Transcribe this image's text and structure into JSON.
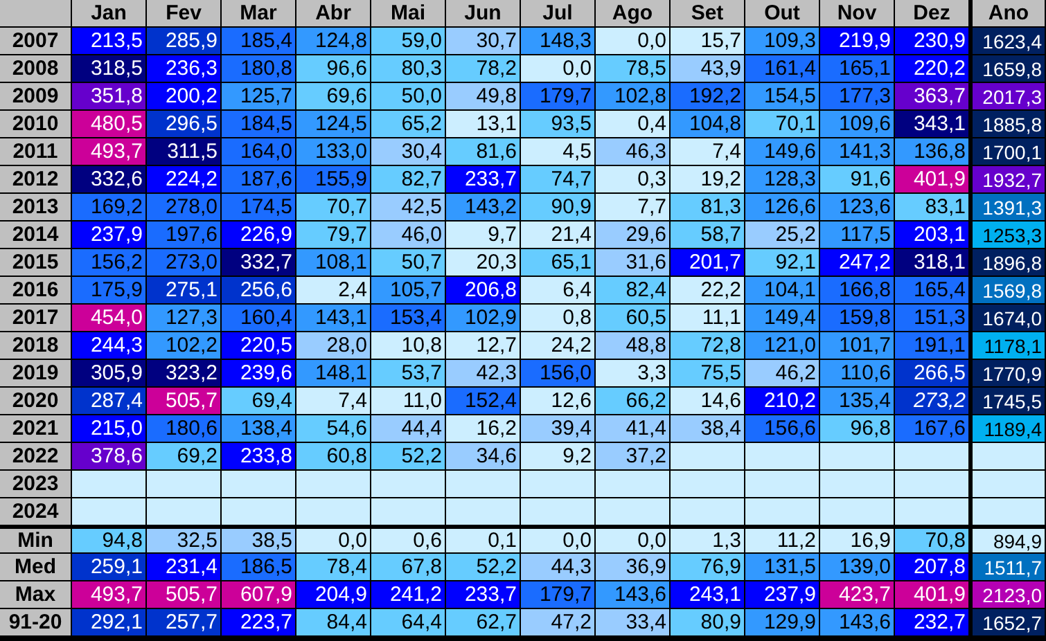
{
  "columns": [
    "Jan",
    "Fev",
    "Mar",
    "Abr",
    "Mai",
    "Jun",
    "Jul",
    "Ago",
    "Set",
    "Out",
    "Nov",
    "Dez",
    "Ano"
  ],
  "rows": [
    {
      "label": "2007",
      "cells": [
        {
          "text": "213,5",
          "color": "#0000ff"
        },
        {
          "text": "285,9",
          "color": "#0033cc"
        },
        {
          "text": "185,4",
          "color": "#1a6cff"
        },
        {
          "text": "124,8",
          "color": "#3399ff"
        },
        {
          "text": "59,0",
          "color": "#66ccff"
        },
        {
          "text": "30,7",
          "color": "#99ccff"
        },
        {
          "text": "148,3",
          "color": "#3399ff"
        },
        {
          "text": "0,0",
          "color": "#cceeff"
        },
        {
          "text": "15,7",
          "color": "#cceeff"
        },
        {
          "text": "109,3",
          "color": "#3399ff"
        },
        {
          "text": "219,9",
          "color": "#0000ff"
        },
        {
          "text": "230,9",
          "color": "#0000ff"
        },
        {
          "text": "1623,4",
          "color": "#002060"
        }
      ]
    },
    {
      "label": "2008",
      "cells": [
        {
          "text": "318,5",
          "color": "#000080"
        },
        {
          "text": "236,3",
          "color": "#0000ff"
        },
        {
          "text": "180,8",
          "color": "#1a6cff"
        },
        {
          "text": "96,6",
          "color": "#66ccff"
        },
        {
          "text": "80,3",
          "color": "#66ccff"
        },
        {
          "text": "78,2",
          "color": "#66ccff"
        },
        {
          "text": "0,0",
          "color": "#cceeff"
        },
        {
          "text": "78,5",
          "color": "#66ccff"
        },
        {
          "text": "43,9",
          "color": "#99ccff"
        },
        {
          "text": "161,4",
          "color": "#1a6cff"
        },
        {
          "text": "165,1",
          "color": "#1a6cff"
        },
        {
          "text": "220,2",
          "color": "#0000ff"
        },
        {
          "text": "1659,8",
          "color": "#002060"
        }
      ]
    },
    {
      "label": "2009",
      "cells": [
        {
          "text": "351,8",
          "color": "#6600cc"
        },
        {
          "text": "200,2",
          "color": "#0000ff"
        },
        {
          "text": "125,7",
          "color": "#3399ff"
        },
        {
          "text": "69,6",
          "color": "#66ccff"
        },
        {
          "text": "50,0",
          "color": "#66ccff"
        },
        {
          "text": "49,8",
          "color": "#99ccff"
        },
        {
          "text": "179,7",
          "color": "#1a6cff"
        },
        {
          "text": "102,8",
          "color": "#3399ff"
        },
        {
          "text": "192,2",
          "color": "#1a6cff"
        },
        {
          "text": "154,5",
          "color": "#3399ff"
        },
        {
          "text": "177,3",
          "color": "#1a6cff"
        },
        {
          "text": "363,7",
          "color": "#6600cc"
        },
        {
          "text": "2017,3",
          "color": "#6600cc"
        }
      ]
    },
    {
      "label": "2010",
      "cells": [
        {
          "text": "480,5",
          "color": "#cc0099"
        },
        {
          "text": "296,5",
          "color": "#0033cc"
        },
        {
          "text": "184,5",
          "color": "#1a6cff"
        },
        {
          "text": "124,5",
          "color": "#3399ff"
        },
        {
          "text": "65,2",
          "color": "#66ccff"
        },
        {
          "text": "13,1",
          "color": "#cceeff"
        },
        {
          "text": "93,5",
          "color": "#66ccff"
        },
        {
          "text": "0,4",
          "color": "#cceeff"
        },
        {
          "text": "104,8",
          "color": "#3399ff"
        },
        {
          "text": "70,1",
          "color": "#66ccff"
        },
        {
          "text": "109,6",
          "color": "#3399ff"
        },
        {
          "text": "343,1",
          "color": "#000080"
        },
        {
          "text": "1885,8",
          "color": "#002060"
        }
      ]
    },
    {
      "label": "2011",
      "cells": [
        {
          "text": "493,7",
          "color": "#cc0099"
        },
        {
          "text": "311,5",
          "color": "#000080"
        },
        {
          "text": "164,0",
          "color": "#1a6cff"
        },
        {
          "text": "133,0",
          "color": "#3399ff"
        },
        {
          "text": "30,4",
          "color": "#99ccff"
        },
        {
          "text": "81,6",
          "color": "#66ccff"
        },
        {
          "text": "4,5",
          "color": "#cceeff"
        },
        {
          "text": "46,3",
          "color": "#99ccff"
        },
        {
          "text": "7,4",
          "color": "#cceeff"
        },
        {
          "text": "149,6",
          "color": "#3399ff"
        },
        {
          "text": "141,3",
          "color": "#3399ff"
        },
        {
          "text": "136,8",
          "color": "#3399ff"
        },
        {
          "text": "1700,1",
          "color": "#002060"
        }
      ]
    },
    {
      "label": "2012",
      "cells": [
        {
          "text": "332,6",
          "color": "#000080"
        },
        {
          "text": "224,2",
          "color": "#0000ff"
        },
        {
          "text": "187,6",
          "color": "#1a6cff"
        },
        {
          "text": "155,9",
          "color": "#1a6cff"
        },
        {
          "text": "82,7",
          "color": "#66ccff"
        },
        {
          "text": "233,7",
          "color": "#0000ff"
        },
        {
          "text": "74,7",
          "color": "#66ccff"
        },
        {
          "text": "0,3",
          "color": "#cceeff"
        },
        {
          "text": "19,2",
          "color": "#cceeff"
        },
        {
          "text": "128,3",
          "color": "#3399ff"
        },
        {
          "text": "91,6",
          "color": "#66ccff"
        },
        {
          "text": "401,9",
          "color": "#cc0099"
        },
        {
          "text": "1932,7",
          "color": "#6600cc"
        }
      ]
    },
    {
      "label": "2013",
      "cells": [
        {
          "text": "169,2",
          "color": "#1a6cff"
        },
        {
          "text": "278,0",
          "color": "#1a6cff"
        },
        {
          "text": "174,5",
          "color": "#1a6cff"
        },
        {
          "text": "70,7",
          "color": "#66ccff"
        },
        {
          "text": "42,5",
          "color": "#99ccff"
        },
        {
          "text": "143,2",
          "color": "#3399ff"
        },
        {
          "text": "90,9",
          "color": "#66ccff"
        },
        {
          "text": "7,7",
          "color": "#cceeff"
        },
        {
          "text": "81,3",
          "color": "#66ccff"
        },
        {
          "text": "126,6",
          "color": "#3399ff"
        },
        {
          "text": "123,6",
          "color": "#3399ff"
        },
        {
          "text": "83,1",
          "color": "#66ccff"
        },
        {
          "text": "1391,3",
          "color": "#0070c0"
        }
      ]
    },
    {
      "label": "2014",
      "cells": [
        {
          "text": "237,9",
          "color": "#0000ff"
        },
        {
          "text": "197,6",
          "color": "#1a6cff"
        },
        {
          "text": "226,9",
          "color": "#0000ff"
        },
        {
          "text": "79,7",
          "color": "#66ccff"
        },
        {
          "text": "46,0",
          "color": "#99ccff"
        },
        {
          "text": "9,7",
          "color": "#cceeff"
        },
        {
          "text": "21,4",
          "color": "#cceeff"
        },
        {
          "text": "29,6",
          "color": "#99ccff"
        },
        {
          "text": "58,7",
          "color": "#66ccff"
        },
        {
          "text": "25,2",
          "color": "#99ccff"
        },
        {
          "text": "117,5",
          "color": "#3399ff"
        },
        {
          "text": "203,1",
          "color": "#0000ff"
        },
        {
          "text": "1253,3",
          "color": "#00b0f0"
        }
      ]
    },
    {
      "label": "2015",
      "cells": [
        {
          "text": "156,2",
          "color": "#1a6cff"
        },
        {
          "text": "273,0",
          "color": "#1a6cff"
        },
        {
          "text": "332,7",
          "color": "#000080"
        },
        {
          "text": "108,1",
          "color": "#3399ff"
        },
        {
          "text": "50,7",
          "color": "#66ccff"
        },
        {
          "text": "20,3",
          "color": "#cceeff"
        },
        {
          "text": "65,1",
          "color": "#66ccff"
        },
        {
          "text": "31,6",
          "color": "#99ccff"
        },
        {
          "text": "201,7",
          "color": "#0000ff"
        },
        {
          "text": "92,1",
          "color": "#66ccff"
        },
        {
          "text": "247,2",
          "color": "#0000ff"
        },
        {
          "text": "318,1",
          "color": "#000080"
        },
        {
          "text": "1896,8",
          "color": "#002060"
        }
      ]
    },
    {
      "label": "2016",
      "cells": [
        {
          "text": "175,9",
          "color": "#1a6cff"
        },
        {
          "text": "275,1",
          "color": "#0033cc"
        },
        {
          "text": "256,6",
          "color": "#0033cc"
        },
        {
          "text": "2,4",
          "color": "#cceeff"
        },
        {
          "text": "105,7",
          "color": "#3399ff"
        },
        {
          "text": "206,8",
          "color": "#0000ff"
        },
        {
          "text": "6,4",
          "color": "#cceeff"
        },
        {
          "text": "82,4",
          "color": "#66ccff"
        },
        {
          "text": "22,2",
          "color": "#cceeff"
        },
        {
          "text": "104,1",
          "color": "#3399ff"
        },
        {
          "text": "166,8",
          "color": "#1a6cff"
        },
        {
          "text": "165,4",
          "color": "#1a6cff"
        },
        {
          "text": "1569,8",
          "color": "#0070c0"
        }
      ]
    },
    {
      "label": "2017",
      "cells": [
        {
          "text": "454,0",
          "color": "#cc0099"
        },
        {
          "text": "127,3",
          "color": "#3399ff"
        },
        {
          "text": "160,4",
          "color": "#1a6cff"
        },
        {
          "text": "143,1",
          "color": "#3399ff"
        },
        {
          "text": "153,4",
          "color": "#1a6cff"
        },
        {
          "text": "102,9",
          "color": "#3399ff"
        },
        {
          "text": "0,8",
          "color": "#cceeff"
        },
        {
          "text": "60,5",
          "color": "#66ccff"
        },
        {
          "text": "11,1",
          "color": "#cceeff"
        },
        {
          "text": "149,4",
          "color": "#3399ff"
        },
        {
          "text": "159,8",
          "color": "#1a6cff"
        },
        {
          "text": "151,3",
          "color": "#1a6cff"
        },
        {
          "text": "1674,0",
          "color": "#002060"
        }
      ]
    },
    {
      "label": "2018",
      "cells": [
        {
          "text": "244,3",
          "color": "#0000ff"
        },
        {
          "text": "102,2",
          "color": "#3399ff"
        },
        {
          "text": "220,5",
          "color": "#0000ff"
        },
        {
          "text": "28,0",
          "color": "#99ccff"
        },
        {
          "text": "10,8",
          "color": "#cceeff"
        },
        {
          "text": "12,7",
          "color": "#cceeff"
        },
        {
          "text": "24,2",
          "color": "#cceeff"
        },
        {
          "text": "48,8",
          "color": "#99ccff"
        },
        {
          "text": "72,8",
          "color": "#66ccff"
        },
        {
          "text": "121,0",
          "color": "#3399ff"
        },
        {
          "text": "101,7",
          "color": "#3399ff"
        },
        {
          "text": "191,1",
          "color": "#1a6cff"
        },
        {
          "text": "1178,1",
          "color": "#00b0f0"
        }
      ]
    },
    {
      "label": "2019",
      "cells": [
        {
          "text": "305,9",
          "color": "#000080"
        },
        {
          "text": "323,2",
          "color": "#000080"
        },
        {
          "text": "239,6",
          "color": "#0000ff"
        },
        {
          "text": "148,1",
          "color": "#3399ff"
        },
        {
          "text": "53,7",
          "color": "#66ccff"
        },
        {
          "text": "42,3",
          "color": "#99ccff"
        },
        {
          "text": "156,0",
          "color": "#1a6cff"
        },
        {
          "text": "3,3",
          "color": "#cceeff"
        },
        {
          "text": "75,5",
          "color": "#66ccff"
        },
        {
          "text": "46,2",
          "color": "#99ccff"
        },
        {
          "text": "110,6",
          "color": "#3399ff"
        },
        {
          "text": "266,5",
          "color": "#0033cc"
        },
        {
          "text": "1770,9",
          "color": "#002060"
        }
      ]
    },
    {
      "label": "2020",
      "cells": [
        {
          "text": "287,4",
          "color": "#0033cc"
        },
        {
          "text": "505,7",
          "color": "#cc0099"
        },
        {
          "text": "69,4",
          "color": "#66ccff"
        },
        {
          "text": "7,4",
          "color": "#cceeff"
        },
        {
          "text": "11,0",
          "color": "#cceeff"
        },
        {
          "text": "152,4",
          "color": "#1a6cff"
        },
        {
          "text": "12,6",
          "color": "#cceeff"
        },
        {
          "text": "66,2",
          "color": "#66ccff"
        },
        {
          "text": "14,6",
          "color": "#cceeff"
        },
        {
          "text": "210,2",
          "color": "#0000ff"
        },
        {
          "text": "135,4",
          "color": "#3399ff"
        },
        {
          "text": "273,2",
          "color": "#0033cc",
          "italic": true
        },
        {
          "text": "1745,5",
          "color": "#002060"
        }
      ]
    },
    {
      "label": "2021",
      "cells": [
        {
          "text": "215,0",
          "color": "#0000ff"
        },
        {
          "text": "180,6",
          "color": "#1a6cff"
        },
        {
          "text": "138,4",
          "color": "#3399ff"
        },
        {
          "text": "54,6",
          "color": "#66ccff"
        },
        {
          "text": "44,4",
          "color": "#99ccff"
        },
        {
          "text": "16,2",
          "color": "#cceeff"
        },
        {
          "text": "39,4",
          "color": "#99ccff"
        },
        {
          "text": "41,4",
          "color": "#99ccff"
        },
        {
          "text": "38,4",
          "color": "#99ccff"
        },
        {
          "text": "156,6",
          "color": "#1a6cff"
        },
        {
          "text": "96,8",
          "color": "#66ccff"
        },
        {
          "text": "167,6",
          "color": "#1a6cff"
        },
        {
          "text": "1189,4",
          "color": "#00b0f0"
        }
      ]
    },
    {
      "label": "2022",
      "cells": [
        {
          "text": "378,6",
          "color": "#6600cc"
        },
        {
          "text": "69,2",
          "color": "#66ccff"
        },
        {
          "text": "233,8",
          "color": "#0000ff"
        },
        {
          "text": "60,8",
          "color": "#66ccff"
        },
        {
          "text": "52,2",
          "color": "#66ccff"
        },
        {
          "text": "34,6",
          "color": "#99ccff"
        },
        {
          "text": "9,2",
          "color": "#cceeff"
        },
        {
          "text": "37,2",
          "color": "#99ccff"
        },
        {
          "color": "#cceeff"
        },
        {
          "color": "#cceeff"
        },
        {
          "color": "#cceeff"
        },
        {
          "color": "#cceeff"
        },
        {
          "color": "#cceeff"
        }
      ]
    },
    {
      "label": "2023",
      "cells": [
        {
          "color": "#cceeff"
        },
        {
          "color": "#cceeff"
        },
        {
          "color": "#cceeff"
        },
        {
          "color": "#cceeff"
        },
        {
          "color": "#cceeff"
        },
        {
          "color": "#cceeff"
        },
        {
          "color": "#cceeff"
        },
        {
          "color": "#cceeff"
        },
        {
          "color": "#cceeff"
        },
        {
          "color": "#cceeff"
        },
        {
          "color": "#cceeff"
        },
        {
          "color": "#cceeff"
        },
        {
          "color": "#cceeff"
        }
      ]
    },
    {
      "label": "2024",
      "cells": [
        {
          "color": "#cceeff"
        },
        {
          "color": "#cceeff"
        },
        {
          "color": "#cceeff"
        },
        {
          "color": "#cceeff"
        },
        {
          "color": "#cceeff"
        },
        {
          "color": "#cceeff"
        },
        {
          "color": "#cceeff"
        },
        {
          "color": "#cceeff"
        },
        {
          "color": "#cceeff"
        },
        {
          "color": "#cceeff"
        },
        {
          "color": "#cceeff"
        },
        {
          "color": "#cceeff"
        },
        {
          "color": "#cceeff"
        }
      ]
    }
  ],
  "summary_rows": [
    {
      "label": "Min",
      "cells": [
        {
          "text": "94,8",
          "color": "#66ccff"
        },
        {
          "text": "32,5",
          "color": "#99ccff"
        },
        {
          "text": "38,5",
          "color": "#99ccff"
        },
        {
          "text": "0,0",
          "color": "#cceeff"
        },
        {
          "text": "0,6",
          "color": "#cceeff"
        },
        {
          "text": "0,1",
          "color": "#cceeff"
        },
        {
          "text": "0,0",
          "color": "#cceeff"
        },
        {
          "text": "0,0",
          "color": "#cceeff"
        },
        {
          "text": "1,3",
          "color": "#cceeff"
        },
        {
          "text": "11,2",
          "color": "#cceeff"
        },
        {
          "text": "16,9",
          "color": "#cceeff"
        },
        {
          "text": "70,8",
          "color": "#66ccff"
        },
        {
          "text": "894,9",
          "color": "#cceeff"
        }
      ]
    },
    {
      "label": "Med",
      "cells": [
        {
          "text": "259,1",
          "color": "#0033cc"
        },
        {
          "text": "231,4",
          "color": "#0000ff"
        },
        {
          "text": "186,5",
          "color": "#1a6cff"
        },
        {
          "text": "78,4",
          "color": "#66ccff"
        },
        {
          "text": "67,8",
          "color": "#66ccff"
        },
        {
          "text": "52,2",
          "color": "#66ccff"
        },
        {
          "text": "44,3",
          "color": "#99ccff"
        },
        {
          "text": "36,9",
          "color": "#99ccff"
        },
        {
          "text": "76,9",
          "color": "#66ccff"
        },
        {
          "text": "131,5",
          "color": "#3399ff"
        },
        {
          "text": "139,0",
          "color": "#3399ff"
        },
        {
          "text": "207,8",
          "color": "#0000ff"
        },
        {
          "text": "1511,7",
          "color": "#0070c0"
        }
      ]
    },
    {
      "label": "Max",
      "cells": [
        {
          "text": "493,7",
          "color": "#cc0099"
        },
        {
          "text": "505,7",
          "color": "#cc0099"
        },
        {
          "text": "607,9",
          "color": "#cc0099"
        },
        {
          "text": "204,9",
          "color": "#0000ff"
        },
        {
          "text": "241,2",
          "color": "#0000ff"
        },
        {
          "text": "233,7",
          "color": "#0000ff"
        },
        {
          "text": "179,7",
          "color": "#1a6cff"
        },
        {
          "text": "143,6",
          "color": "#3399ff"
        },
        {
          "text": "243,1",
          "color": "#0000ff"
        },
        {
          "text": "237,9",
          "color": "#0000ff"
        },
        {
          "text": "423,7",
          "color": "#cc0099"
        },
        {
          "text": "401,9",
          "color": "#cc0099"
        },
        {
          "text": "2123,0",
          "color": "#b400b4"
        }
      ]
    },
    {
      "label": "91-20",
      "cells": [
        {
          "text": "292,1",
          "color": "#0033cc"
        },
        {
          "text": "257,7",
          "color": "#0033cc"
        },
        {
          "text": "223,7",
          "color": "#0000ff"
        },
        {
          "text": "84,4",
          "color": "#66ccff"
        },
        {
          "text": "64,4",
          "color": "#66ccff"
        },
        {
          "text": "62,7",
          "color": "#66ccff"
        },
        {
          "text": "47,2",
          "color": "#99ccff"
        },
        {
          "text": "33,4",
          "color": "#99ccff"
        },
        {
          "text": "80,9",
          "color": "#66ccff"
        },
        {
          "text": "129,9",
          "color": "#3399ff"
        },
        {
          "text": "143,6",
          "color": "#3399ff"
        },
        {
          "text": "232,7",
          "color": "#0000ff"
        },
        {
          "text": "1652,7",
          "color": "#002060"
        }
      ]
    }
  ]
}
